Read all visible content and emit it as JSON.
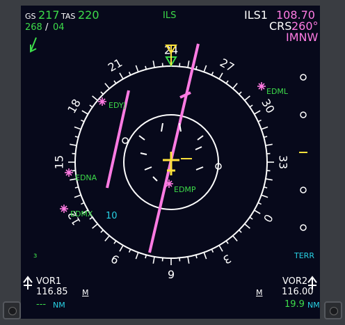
{
  "top_left": {
    "gs_label": "GS",
    "gs_value": "217",
    "tas_label": "TAS",
    "tas_value": "220",
    "wind_dir": "268",
    "wind_sep": "/",
    "wind_speed": "04"
  },
  "mode": "ILS",
  "top_right": {
    "source": "ILS1",
    "freq": "108.70",
    "crs_label": "CRS",
    "crs_value": "260°",
    "ident": "IMNW"
  },
  "compass_labels": [
    "24",
    "27",
    "30",
    "33",
    "0",
    "3",
    "6",
    "9",
    "12",
    "15",
    "18",
    "21"
  ],
  "waypoints": [
    "EDYJ",
    "EDML",
    "EDNA",
    "EDMP",
    "EDMX"
  ],
  "range_label": "10",
  "terr_label": "TERR",
  "bottom_left": {
    "nav": "VOR1",
    "freq": "116.85",
    "mag": "M",
    "dist": "---",
    "unit": "NM"
  },
  "bottom_right": {
    "nav": "VOR2",
    "freq": "116.00",
    "mag": "M",
    "dist": "19.9",
    "unit": "NM"
  },
  "colors": {
    "white": "#ffffff",
    "green": "#3ddc4a",
    "magenta": "#ff7be3",
    "cyan": "#28d3e6",
    "yellow": "#ffe23b",
    "background": "#07091b"
  }
}
